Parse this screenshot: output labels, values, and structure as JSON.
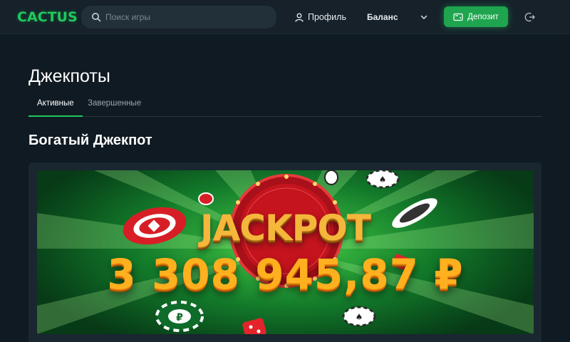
{
  "header": {
    "logo": "CACTUS",
    "search": {
      "placeholder": "Поиск игры",
      "value": ""
    },
    "profile_label": "Профиль",
    "balance_label": "Баланс",
    "deposit_label": "Депозит",
    "accent_color": "#20c95c"
  },
  "page": {
    "title": "Джекпоты",
    "tabs": [
      {
        "label": "Активные",
        "active": true
      },
      {
        "label": "Завершенные",
        "active": false
      }
    ],
    "section_title": "Богатый Джекпот",
    "banner": {
      "heading": "JACKPOT",
      "amount": "3 308 945,87 ₽"
    }
  },
  "icons": {
    "search": "search-icon",
    "profile": "user-icon",
    "chevron": "chevron-down-icon",
    "deposit": "wallet-icon",
    "logout": "logout-icon"
  }
}
